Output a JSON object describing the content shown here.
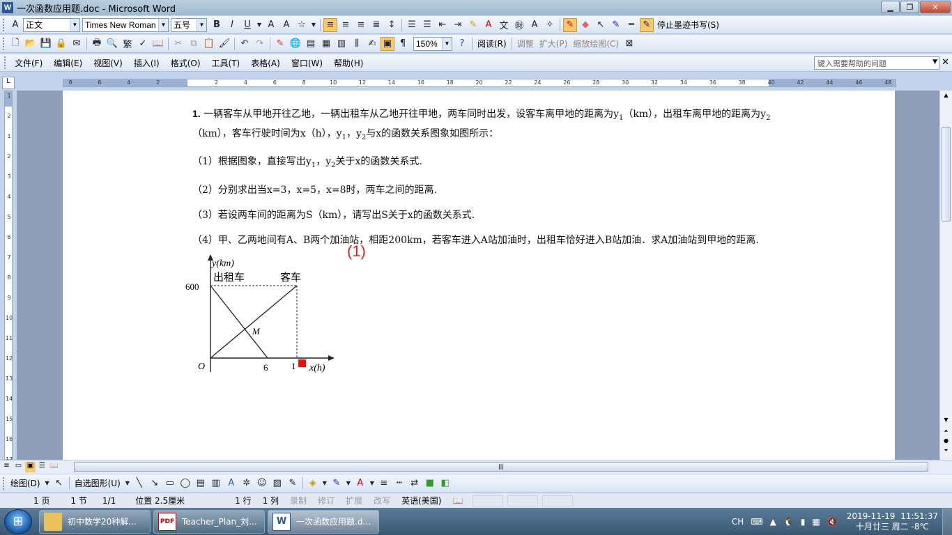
{
  "window": {
    "title": "一次函数应用题.doc - Microsoft Word",
    "app_icon": "W"
  },
  "format_toolbar": {
    "style": "正文",
    "font": "Times New Roman",
    "size": "五号",
    "stop_ink": "停止墨迹书写(S)"
  },
  "standard_toolbar": {
    "zoom": "150%",
    "read": "阅读(R)",
    "adjust": "调整",
    "expand": "扩大(P)",
    "zoom_draw": "缩放绘图(C)"
  },
  "menu": {
    "items": [
      "文件(F)",
      "编辑(E)",
      "视图(V)",
      "插入(I)",
      "格式(O)",
      "工具(T)",
      "表格(A)",
      "窗口(W)",
      "帮助(H)"
    ],
    "help_placeholder": "键入需要帮助的问题"
  },
  "ruler": {
    "h_labels": [
      "8",
      "6",
      "4",
      "2",
      "",
      "2",
      "4",
      "6",
      "8",
      "10",
      "12",
      "14",
      "16",
      "18",
      "20",
      "22",
      "24",
      "26",
      "28",
      "30",
      "32",
      "34",
      "36",
      "38",
      "40",
      "42",
      "44",
      "46",
      "48"
    ],
    "v_labels": [
      "1",
      "2",
      "1",
      "2",
      "3",
      "4",
      "5",
      "6",
      "7",
      "8",
      "9",
      "10",
      "11",
      "12",
      "13",
      "14",
      "15",
      "16",
      "17"
    ]
  },
  "document": {
    "q_num": "1.",
    "p1_a": " 一辆客车从甲地开往乙地，一辆出租车从乙地开往甲地，两车同时出发，设客车离甲地的距离为y",
    "p1_sub1": "1",
    "p1_b": "（km），出租车离甲地的距离为y",
    "p1_sub2": "2",
    "p1_c": "（km），客车行驶时间为x（h），y",
    "p1_sub3": "1",
    "p1_d": "，y",
    "p1_sub4": "2",
    "p1_e": "与x的函数关系图象如图所示：",
    "q1_a": "（1）根据图象，直接写出y",
    "q1_sub1": "1",
    "q1_b": "，y",
    "q1_sub2": "2",
    "q1_c": "关于x的函数关系式.",
    "q2": "（2）分别求出当x=3，x=5，x=8时，两车之间的距离.",
    "q3": "（3）若设两车间的距离为S（km），请写出S关于x的函数关系式.",
    "q4": "（4）甲、乙两地间有A、B两个加油站，相距200km，若客车进入A站加油时，出租车恰好进入B站加油．求A加油站到甲地的距离.",
    "ink_annotation": "(1)"
  },
  "graph": {
    "y_axis_label": "y(km)",
    "x_axis_label": "x(h)",
    "origin": "O",
    "y_tick": "600",
    "x_tick_taxi": "6",
    "x_tick_bus": "1",
    "label_taxi": "出租车",
    "label_bus": "客车",
    "label_m": "M",
    "colors": {
      "marker": "#e8100c"
    }
  },
  "status": {
    "page": "1 页",
    "section": "1 节",
    "pages": "1/1",
    "position": "位置 2.5厘米",
    "line": "1 行",
    "col": "1 列",
    "rec": "录制",
    "trk": "修订",
    "ext": "扩展",
    "ovr": "改写",
    "lang": "英语(美国)"
  },
  "drawing_toolbar": {
    "draw": "绘图(D)",
    "autoshapes": "自选图形(U)"
  },
  "taskbar": {
    "buttons": [
      {
        "label": "初中数学20种解...",
        "icon": "folder-icon"
      },
      {
        "label": "Teacher_Plan_刘...",
        "icon": "pdf-icon"
      },
      {
        "label": "一次函数应用题.d...",
        "icon": "word-icon"
      }
    ],
    "ime": "CH",
    "date": "2019-11-19",
    "time": "11:51:37",
    "lunar": "十月廿三 周二 -8℃"
  }
}
